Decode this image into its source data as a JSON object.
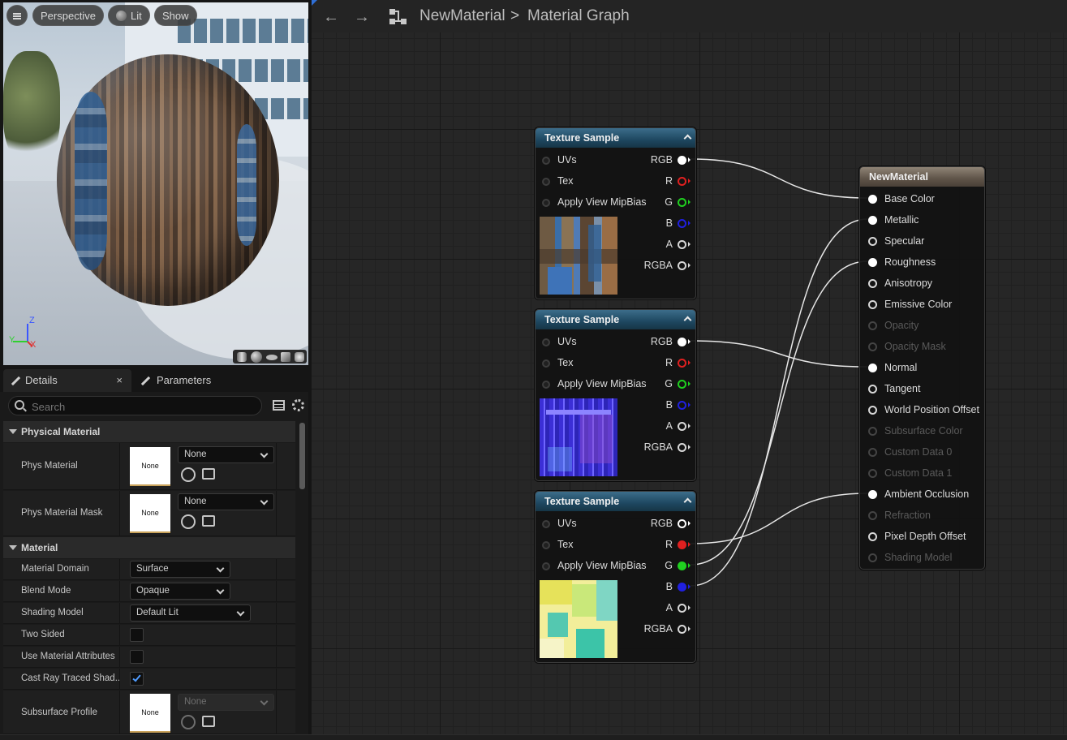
{
  "viewport": {
    "menu_icon": "hamburger-icon",
    "perspective_label": "Perspective",
    "lit_label": "Lit",
    "show_label": "Show",
    "axis_z": "Z",
    "axis_y": "Y",
    "axis_x": "X",
    "preview_shapes": [
      "cylinder-icon",
      "sphere-icon",
      "plane-icon",
      "cube-icon",
      "teapot-icon"
    ]
  },
  "details": {
    "tab_details": "Details",
    "tab_parameters": "Parameters",
    "search_placeholder": "Search",
    "physical_material": {
      "header": "Physical Material",
      "phys_material_label": "Phys Material",
      "phys_material_value": "None",
      "phys_material_thumb": "None",
      "phys_material_mask_label": "Phys Material Mask",
      "phys_material_mask_value": "None",
      "phys_material_mask_thumb": "None"
    },
    "material": {
      "header": "Material",
      "domain_label": "Material Domain",
      "domain_value": "Surface",
      "blend_label": "Blend Mode",
      "blend_value": "Opaque",
      "shading_label": "Shading Model",
      "shading_value": "Default Lit",
      "two_sided_label": "Two Sided",
      "two_sided": false,
      "use_attr_label": "Use Material Attributes",
      "use_attr": false,
      "cast_ray_label": "Cast Ray Traced Shad...",
      "cast_ray": true,
      "subsurface_label": "Subsurface Profile",
      "subsurface_value": "None",
      "subsurface_thumb": "None"
    }
  },
  "breadcrumb": {
    "back_icon": "arrow-left-icon",
    "forward_icon": "arrow-right-icon",
    "graph_icon": "node-graph-icon",
    "material": "NewMaterial",
    "separator": ">",
    "graph": "Material Graph"
  },
  "nodes": {
    "texture_title": "Texture Sample",
    "inputs": [
      "UVs",
      "Tex",
      "Apply View MipBias"
    ],
    "outputs": [
      "RGB",
      "R",
      "G",
      "B",
      "A",
      "RGBA"
    ],
    "output_colors": {
      "RGB": "#ffffff",
      "R": "#e02020",
      "G": "#20d020",
      "B": "#2020e0",
      "A": "#d8d8d8",
      "RGBA": "#d8d8d8"
    },
    "material_title": "NewMaterial",
    "material_pins": [
      {
        "label": "Base Color",
        "state": "connected"
      },
      {
        "label": "Metallic",
        "state": "connected"
      },
      {
        "label": "Specular",
        "state": "open"
      },
      {
        "label": "Roughness",
        "state": "connected"
      },
      {
        "label": "Anisotropy",
        "state": "open"
      },
      {
        "label": "Emissive Color",
        "state": "open"
      },
      {
        "label": "Opacity",
        "state": "disabled"
      },
      {
        "label": "Opacity Mask",
        "state": "disabled"
      },
      {
        "label": "Normal",
        "state": "connected"
      },
      {
        "label": "Tangent",
        "state": "open"
      },
      {
        "label": "World Position Offset",
        "state": "open"
      },
      {
        "label": "Subsurface Color",
        "state": "disabled"
      },
      {
        "label": "Custom Data 0",
        "state": "disabled"
      },
      {
        "label": "Custom Data 1",
        "state": "disabled"
      },
      {
        "label": "Ambient Occlusion",
        "state": "connected"
      },
      {
        "label": "Refraction",
        "state": "disabled"
      },
      {
        "label": "Pixel Depth Offset",
        "state": "open"
      },
      {
        "label": "Shading Model",
        "state": "disabled"
      }
    ]
  }
}
